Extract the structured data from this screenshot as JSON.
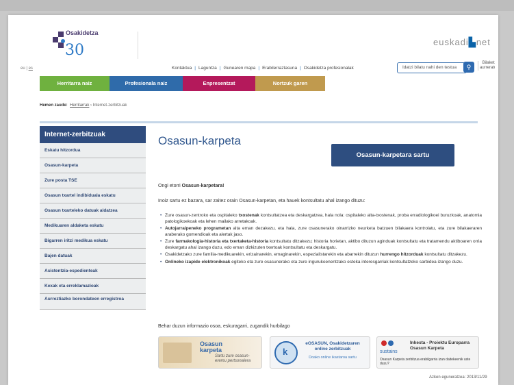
{
  "header": {
    "logo_text": "Osakidetza",
    "logo_badge": "30",
    "logo_badge_sub": "urte años",
    "brand_prefix": "euskadi",
    "brand_suffix": "net"
  },
  "lang": {
    "current": "eu",
    "other": "es"
  },
  "top_links": [
    "Kontaktua",
    "Laguntza",
    "Gunearen mapa",
    "Erabilerraztasuna",
    "Osakidetza profesionalak"
  ],
  "search": {
    "placeholder": "Idatzi bilatu nahi den testua",
    "advanced": "Bilaketa aurreratua"
  },
  "nav_tabs": [
    {
      "label": "Herritarra naiz",
      "color": "#6fb13f"
    },
    {
      "label": "Profesionala naiz",
      "color": "#2f6baa"
    },
    {
      "label": "Enpresentzat",
      "color": "#b4195b"
    },
    {
      "label": "Nortzuk garen",
      "color": "#c09a4e"
    }
  ],
  "breadcrumb": {
    "label": "Hemen zaude:",
    "home": "Herritarrak",
    "separator": "›",
    "current": "Internet-zerbitzuak"
  },
  "sidebar": {
    "title": "Internet-zerbitzuak",
    "items": [
      "Eskatu hitzordua",
      "Osasun-karpeta",
      "Zure posta TSE",
      "Osasun txartel indibiduala eskatu",
      "Osasun txarteleko datuak aldatzea",
      "Medikuaren aldaketa eskatu",
      "Bigarren iritzi medikua eskatu",
      "Bajen datuak",
      "Asistentzia-espedienteak",
      "Kexak eta erreklamazioak",
      "Aurreztiazko borondateen erregistroa"
    ]
  },
  "content": {
    "title": "Osasun-karpeta",
    "cta": "Osasun-karpetara sartu",
    "welcome_pre": "Ongi etorri ",
    "welcome_bold": "Osasun-karpetara!",
    "intro": "Inoiz sartu ez bazara, sar zaitez orain Osasun-karpetan, eta hauek kontsultatu ahal izango dituzu:",
    "bullets": [
      {
        "pre": "Zure osasun-zentroko eta ospitaleko ",
        "bold": "txostenak",
        "post": " kontsultatzea eta deskargatzea, hala nola: ospitaleko alta-txostenak, proba erradiologikoei buruzkoak, anatomia patologikoekoak eta lehen mailako arretakoak."
      },
      {
        "pre": "",
        "bold": "Autojarraipeneko programetan",
        "post": " alta eman dezakezu, eta hala, zure osasunerako oinarrizko neurketa batzuen bilakaera kontrolatu, eta zure bilakaeraren araberako gomendioak eta alertak jaso."
      },
      {
        "pre": "Zure ",
        "bold": "farmakologia-historia eta txertaketa-historia",
        "post": " kontsultatu ditzakezu; historia horietan, aktibo dituzun aginduak kontsultatu eta tratamendu aktiboaren orria deskargatu ahal izango duzu, edo eman dizkizuten txertoak kontsultatu eta deskargatu."
      },
      {
        "pre": "Osakidetzako zure familia-medikuarekin, erizainarekin, emaginarekin, espezialistarekin eta abarrekin dituzun ",
        "bold": "hurrengo hitzorduak",
        "post": " kontsultatu ditzakezu."
      },
      {
        "pre": "",
        "bold": "Onlineko izapide elektronikoak",
        "post": " egiteko eta zure osasunerako eta zure ingurukoenentzako esteka interesgarriak kontsultatzeko sarbidea izango duzu."
      }
    ],
    "footer_note": "Behar duzun informazio osoa, eskuragarri, zugandik hurbilago",
    "updated": "Azken eguneratzea: 2013/11/29"
  },
  "promos": [
    {
      "title_1": "Osasun",
      "title_2": "karpeta",
      "subtitle": "Sartu zure osasun-eremu pertsonalera"
    },
    {
      "title": "eOSASUN, Osakidetzaren online zerbitzuak",
      "subtitle": "Doako online ikastaroa sartu",
      "badge": "k"
    },
    {
      "title": "Inkesta - Proiektu Europarra Osasun Karpeta",
      "logo": "sustains",
      "subtitle": "Osasun Karpeta zerbitzua erabilgarria izan daitekeenik uste duzu?"
    }
  ],
  "colors": {
    "sidebar_title": "#2f4c7e",
    "cta": "#2e4e80",
    "title": "#33598f"
  }
}
